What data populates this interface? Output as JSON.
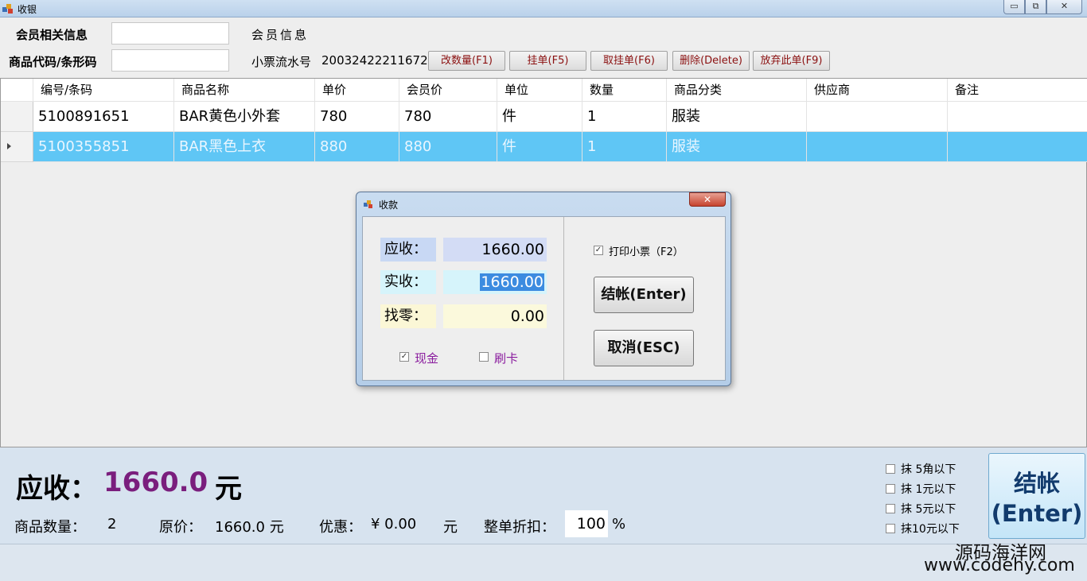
{
  "window": {
    "title": "收银",
    "btn_min": "▭",
    "btn_max": "⧉",
    "btn_close": "✕"
  },
  "form": {
    "member_label": "会员相关信息",
    "member_value": "",
    "product_label": "商品代码/条形码",
    "product_value": "",
    "member_info_label": "会员信息",
    "ticket_label": "小票流水号",
    "ticket_no": "20032422211672",
    "buttons": [
      "改数量(F1)",
      "挂单(F5)",
      "取挂单(F6)",
      "删除(Delete)",
      "放弃此单(F9)"
    ]
  },
  "grid": {
    "headers": [
      "编号/条码",
      "商品名称",
      "单价",
      "会员价",
      "单位",
      "数量",
      "商品分类",
      "供应商",
      "备注"
    ],
    "rows": [
      [
        "5100891651",
        "BAR黄色小外套",
        "780",
        "780",
        "件",
        "1",
        "服装",
        "",
        ""
      ],
      [
        "5100355851",
        "BAR黑色上衣",
        "880",
        "880",
        "件",
        "1",
        "服装",
        "",
        ""
      ]
    ]
  },
  "dialog": {
    "title": "收款",
    "close": "✕",
    "receivable_label": "应收：",
    "receivable": "1660.00",
    "paid_label": "实收：",
    "paid": "1660.00",
    "change_label": "找零：",
    "change": "0.00",
    "cash_label": "现金",
    "cash_checked": true,
    "card_label": "刷卡",
    "card_checked": false,
    "print_label": "打印小票（F2）",
    "print_checked": true,
    "checkout_label": "结帐(Enter)",
    "cancel_label": "取消(ESC)"
  },
  "summary": {
    "receivable_label": "应收：",
    "receivable": "1660.0",
    "unit": "元",
    "count_label": "商品数量：",
    "count": "2",
    "original_label": "原价：",
    "original": "1660.0 元",
    "discount_label": "优惠：",
    "discount": "¥ 0.00",
    "discount_unit": "元",
    "overall_label": "整单折扣：",
    "overall": "100",
    "percent": "%",
    "rounding": [
      "抹  5角以下",
      "抹  1元以下",
      "抹  5元以下",
      "抹10元以下"
    ],
    "checkout_line1": "结帐",
    "checkout_line2": "(Enter)"
  },
  "watermark": {
    "line1": "源码海洋网",
    "line2": "www.codehy.com"
  },
  "colors": {
    "selected_row": "#5fc6f5",
    "amount": "#7a1e7d",
    "button_text": "#8b1010"
  }
}
